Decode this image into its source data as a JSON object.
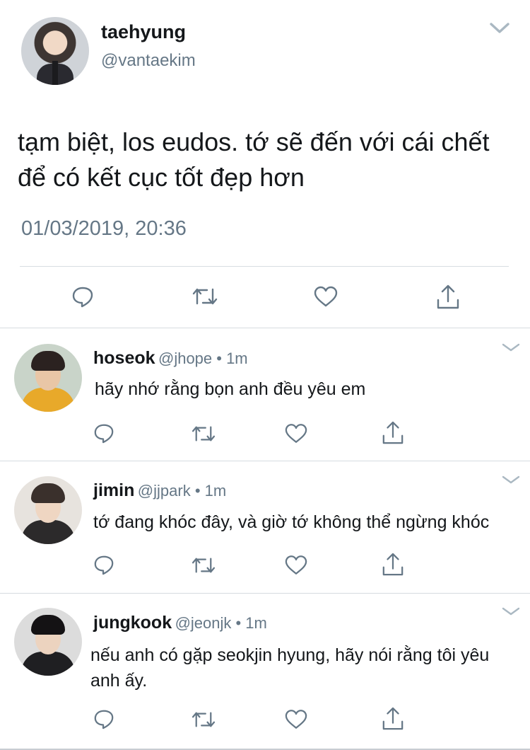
{
  "main_tweet": {
    "name": "taehyung",
    "handle": "@vantaekim",
    "text": "tạm biệt, los eudos. tớ sẽ đến với cái chết để có kết cục tốt đẹp hơn",
    "timestamp": "01/03/2019, 20:36"
  },
  "replies": [
    {
      "name": "hoseok",
      "handle_meta": "@jhope • 1m",
      "text": "hãy nhớ rằng bọn anh đều yêu em"
    },
    {
      "name": "jimin",
      "handle_meta": "@jjpark • 1m",
      "text": "tớ đang khóc đây, và giờ tớ không thể ngừng khóc"
    },
    {
      "name": "jungkook",
      "handle_meta": "@jeonjk • 1m",
      "text": "nếu anh có gặp seokjin hyung, hãy nói rằng tôi yêu anh ấy."
    }
  ],
  "icons": {
    "reply": "reply-icon",
    "retweet": "retweet-icon",
    "like": "like-icon",
    "share": "share-icon",
    "menu": "chevron-down-icon"
  },
  "colors": {
    "text": "#14171a",
    "secondary": "#657786",
    "divider": "#d6dbe0"
  }
}
